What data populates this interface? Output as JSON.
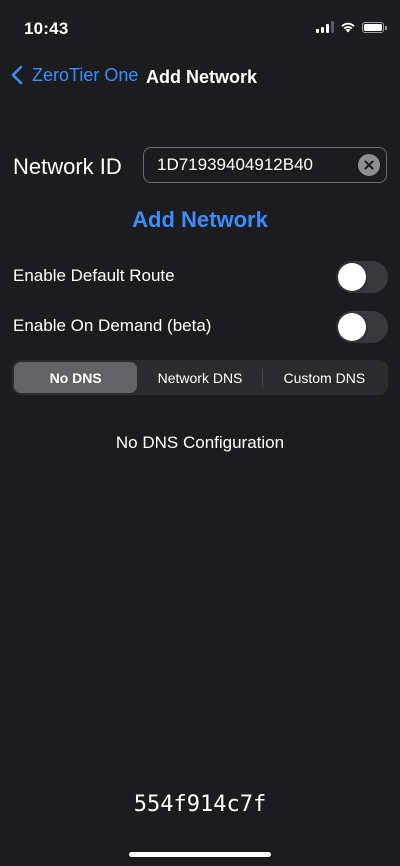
{
  "status_bar": {
    "time": "10:43",
    "icons": [
      "cellular-signal-icon",
      "wifi-icon",
      "battery-icon"
    ]
  },
  "nav": {
    "back_label": "ZeroTier One",
    "title": "Add Network",
    "back_icon": "chevron-left-icon"
  },
  "form": {
    "network_id_label": "Network ID",
    "network_id_value": "1D71939404912B40",
    "clear_icon": "clear-circle-icon",
    "add_button_label": "Add Network"
  },
  "toggles": [
    {
      "label": "Enable Default Route",
      "on": false
    },
    {
      "label": "Enable On Demand (beta)",
      "on": false
    }
  ],
  "dns_segments": {
    "options": [
      "No DNS",
      "Network DNS",
      "Custom DNS"
    ],
    "selected": "No DNS"
  },
  "dns_status": "No DNS Configuration",
  "footer_id": "554f914c7f",
  "colors": {
    "background": "#1c1c1e",
    "accent": "#3d8bff",
    "toggle_off": "#39393d",
    "segment_selected": "#636366"
  }
}
